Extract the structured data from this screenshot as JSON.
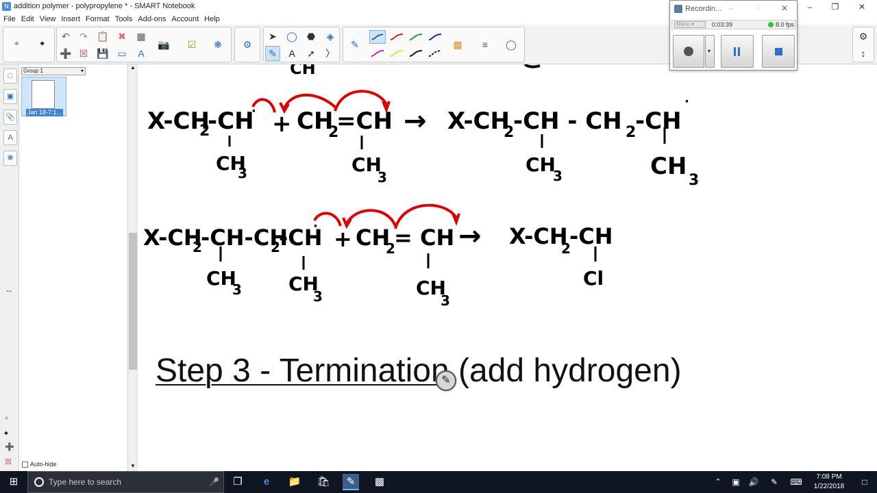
{
  "window": {
    "title": "addition polymer - polypropylene * - SMART Notebook",
    "app_icon": "notebook-icon"
  },
  "menu": [
    "File",
    "Edit",
    "View",
    "Insert",
    "Format",
    "Tools",
    "Add-ons",
    "Account",
    "Help"
  ],
  "sorter": {
    "group_label": "Group 1",
    "thumb_caption": "Jan 18-7:1...",
    "autohide_label": "Auto-hide"
  },
  "recorder": {
    "title": "Recordin...",
    "menu_label": "Menu",
    "time": "0:03:39",
    "fps": "8.0 fps"
  },
  "canvas": {
    "step_heading": "Step 3 - Termination",
    "step_heading_rest": " (add hydrogen)",
    "row1": {
      "left": "X-CH",
      "sub2": "2",
      "mid": "-CH",
      "dot": "·",
      "plus": "+",
      "m1": "CH",
      "m1sub": "2",
      "m2": "=CH",
      "arrow": "→",
      "right": "X-CH",
      "right_sub": "2",
      "right_mid": "-CH - CH",
      "right_sub2": "2",
      "right_end": "-CH"
    },
    "row2": {
      "left": "X-CH",
      "mid": "-CH-CH",
      "mid2": "-CH",
      "plus": "+",
      "m1": "CH",
      "m2": "= CH",
      "arrow": "→",
      "right": "X-CH",
      "right_mid": "-CH"
    },
    "ch3": "CH",
    "three": "3",
    "cl": "Cl"
  },
  "taskbar": {
    "search_placeholder": "Type here to search",
    "time": "7:08 PM",
    "date": "1/22/2018"
  },
  "colors": {
    "accent": "#2a6fb5",
    "reaction_arrows": "#e00000",
    "taskbar": "#101621"
  }
}
